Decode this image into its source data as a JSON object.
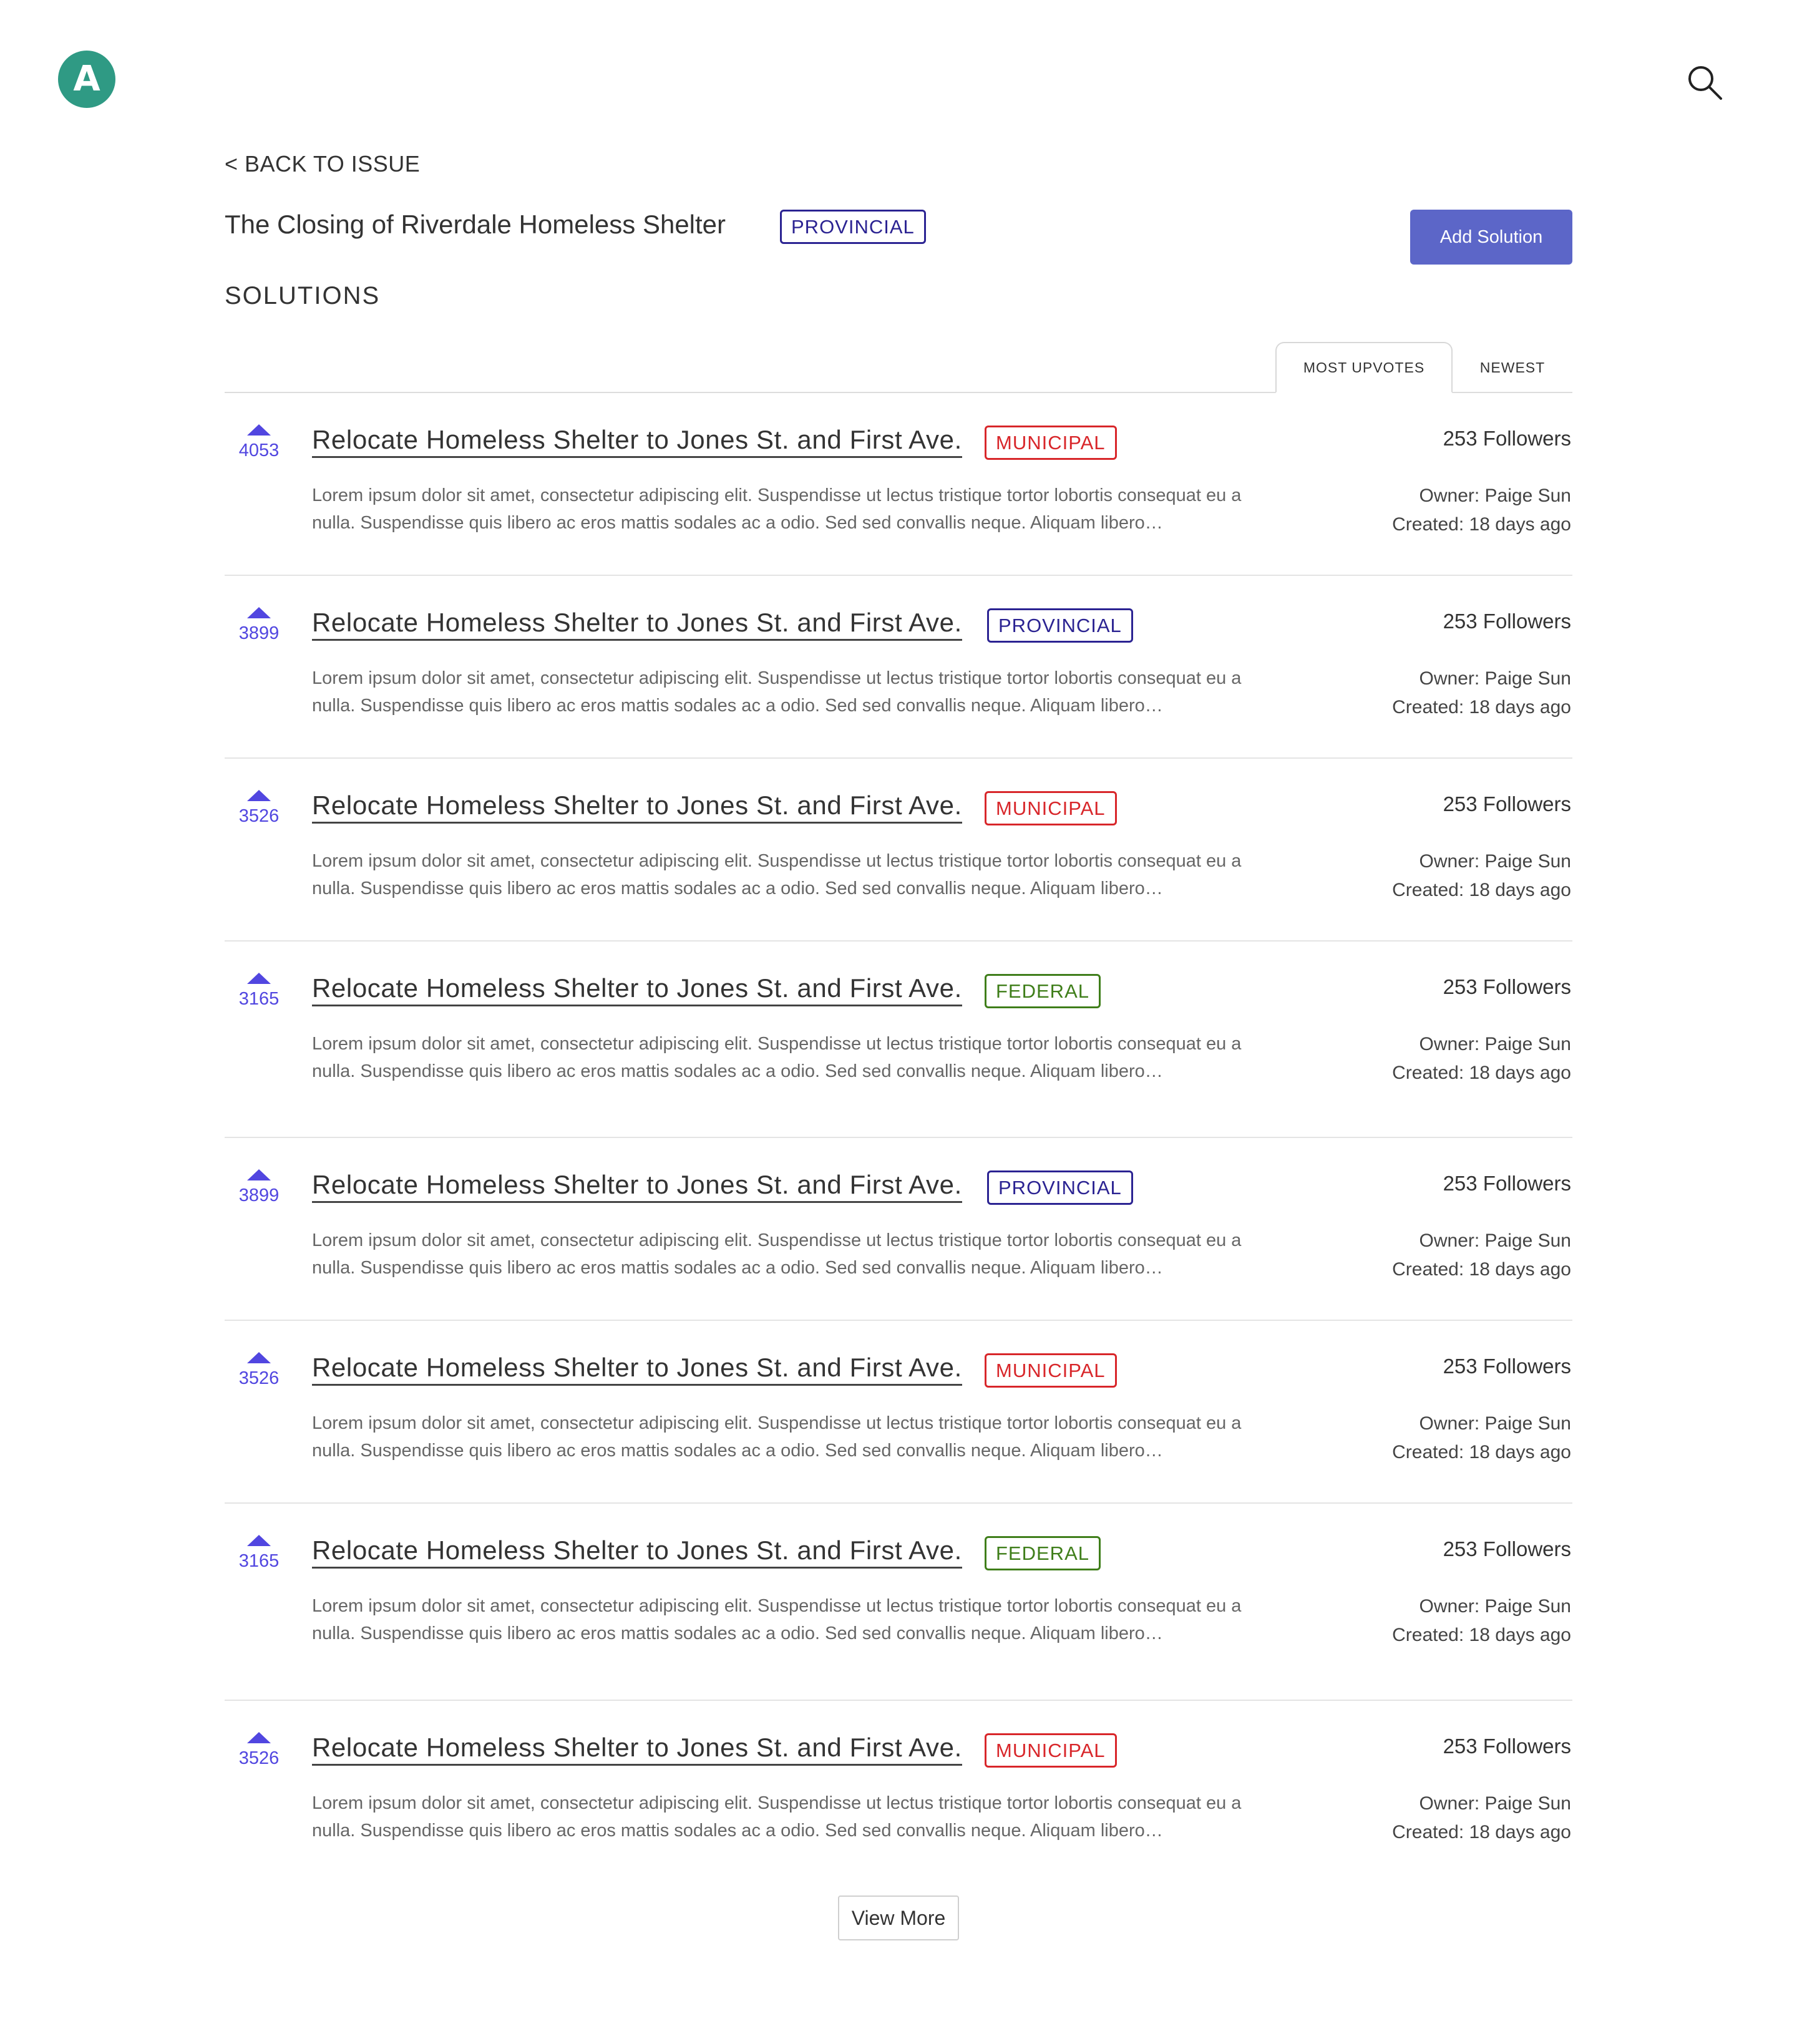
{
  "header": {
    "logo_letter": "A",
    "search_icon": "search-icon"
  },
  "page": {
    "back_link": "< BACK TO ISSUE",
    "issue_title": "The Closing of Riverdale Homeless Shelter",
    "issue_badge": "PROVINCIAL",
    "add_button": "Add Solution",
    "section_heading": "SOLUTIONS"
  },
  "tabs": [
    {
      "label": "MOST UPVOTES",
      "active": true
    },
    {
      "label": "NEWEST",
      "active": false
    }
  ],
  "badge_colors": {
    "PROVINCIAL": "#2b2392",
    "MUNICIPAL": "#d8262a",
    "FEDERAL": "#3f7e1a"
  },
  "accent_color": "#5c66c8",
  "vote_color": "#5146e0",
  "solutions": [
    {
      "votes": "4053",
      "title": "Relocate Homeless Shelter to Jones St. and First Ave.",
      "badge": "MUNICIPAL",
      "description": "Lorem ipsum dolor sit amet, consectetur adipiscing elit. Suspendisse ut lectus tristique tortor lobortis consequat eu a nulla. Suspendisse quis libero ac eros mattis sodales ac a odio. Sed sed convallis neque. Aliquam libero…",
      "followers": "253 Followers",
      "owner": "Owner: Paige Sun",
      "created": "Created: 18 days ago"
    },
    {
      "votes": "3899",
      "title": "Relocate Homeless Shelter to Jones St. and First Ave.",
      "badge": "PROVINCIAL",
      "description": "Lorem ipsum dolor sit amet, consectetur adipiscing elit. Suspendisse ut lectus tristique tortor lobortis consequat eu a nulla. Suspendisse quis libero ac eros mattis sodales ac a odio. Sed sed convallis neque. Aliquam libero…",
      "followers": "253 Followers",
      "owner": "Owner: Paige Sun",
      "created": "Created: 18 days ago"
    },
    {
      "votes": "3526",
      "title": "Relocate Homeless Shelter to Jones St. and First Ave.",
      "badge": "MUNICIPAL",
      "description": "Lorem ipsum dolor sit amet, consectetur adipiscing elit. Suspendisse ut lectus tristique tortor lobortis consequat eu a nulla. Suspendisse quis libero ac eros mattis sodales ac a odio. Sed sed convallis neque. Aliquam libero…",
      "followers": "253 Followers",
      "owner": "Owner: Paige Sun",
      "created": "Created: 18 days ago"
    },
    {
      "votes": "3165",
      "title": "Relocate Homeless Shelter to Jones St. and First Ave.",
      "badge": "FEDERAL",
      "description": "Lorem ipsum dolor sit amet, consectetur adipiscing elit. Suspendisse ut lectus tristique tortor lobortis consequat eu a nulla. Suspendisse quis libero ac eros mattis sodales ac a odio. Sed sed convallis neque. Aliquam libero…",
      "followers": "253 Followers",
      "owner": "Owner: Paige Sun",
      "created": "Created: 18 days ago"
    },
    {
      "votes": "3899",
      "title": "Relocate Homeless Shelter to Jones St. and First Ave.",
      "badge": "PROVINCIAL",
      "description": "Lorem ipsum dolor sit amet, consectetur adipiscing elit. Suspendisse ut lectus tristique tortor lobortis consequat eu a nulla. Suspendisse quis libero ac eros mattis sodales ac a odio. Sed sed convallis neque. Aliquam libero…",
      "followers": "253 Followers",
      "owner": "Owner: Paige Sun",
      "created": "Created: 18 days ago"
    },
    {
      "votes": "3526",
      "title": "Relocate Homeless Shelter to Jones St. and First Ave.",
      "badge": "MUNICIPAL",
      "description": "Lorem ipsum dolor sit amet, consectetur adipiscing elit. Suspendisse ut lectus tristique tortor lobortis consequat eu a nulla. Suspendisse quis libero ac eros mattis sodales ac a odio. Sed sed convallis neque. Aliquam libero…",
      "followers": "253 Followers",
      "owner": "Owner: Paige Sun",
      "created": "Created: 18 days ago"
    },
    {
      "votes": "3165",
      "title": "Relocate Homeless Shelter to Jones St. and First Ave.",
      "badge": "FEDERAL",
      "description": "Lorem ipsum dolor sit amet, consectetur adipiscing elit. Suspendisse ut lectus tristique tortor lobortis consequat eu a nulla. Suspendisse quis libero ac eros mattis sodales ac a odio. Sed sed convallis neque. Aliquam libero…",
      "followers": "253 Followers",
      "owner": "Owner: Paige Sun",
      "created": "Created: 18 days ago"
    },
    {
      "votes": "3526",
      "title": "Relocate Homeless Shelter to Jones St. and First Ave.",
      "badge": "MUNICIPAL",
      "description": "Lorem ipsum dolor sit amet, consectetur adipiscing elit. Suspendisse ut lectus tristique tortor lobortis consequat eu a nulla. Suspendisse quis libero ac eros mattis sodales ac a odio. Sed sed convallis neque. Aliquam libero…",
      "followers": "253 Followers",
      "owner": "Owner: Paige Sun",
      "created": "Created: 18 days ago"
    }
  ],
  "view_more": "View More"
}
